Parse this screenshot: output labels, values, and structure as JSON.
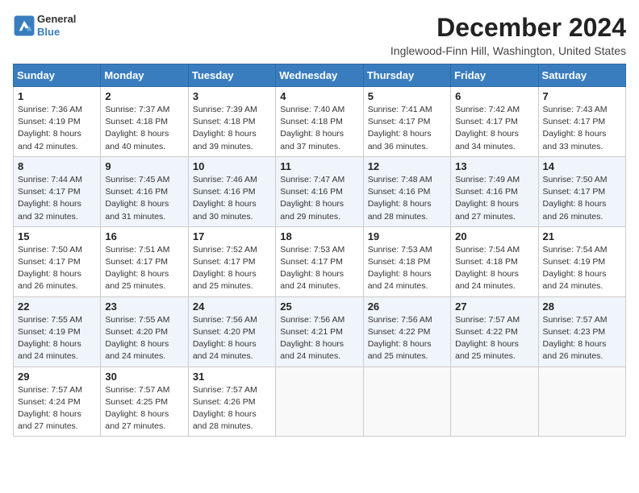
{
  "logo": {
    "general": "General",
    "blue": "Blue"
  },
  "title": "December 2024",
  "location": "Inglewood-Finn Hill, Washington, United States",
  "headers": [
    "Sunday",
    "Monday",
    "Tuesday",
    "Wednesday",
    "Thursday",
    "Friday",
    "Saturday"
  ],
  "weeks": [
    [
      {
        "day": "1",
        "sunrise": "Sunrise: 7:36 AM",
        "sunset": "Sunset: 4:19 PM",
        "daylight": "Daylight: 8 hours and 42 minutes."
      },
      {
        "day": "2",
        "sunrise": "Sunrise: 7:37 AM",
        "sunset": "Sunset: 4:18 PM",
        "daylight": "Daylight: 8 hours and 40 minutes."
      },
      {
        "day": "3",
        "sunrise": "Sunrise: 7:39 AM",
        "sunset": "Sunset: 4:18 PM",
        "daylight": "Daylight: 8 hours and 39 minutes."
      },
      {
        "day": "4",
        "sunrise": "Sunrise: 7:40 AM",
        "sunset": "Sunset: 4:18 PM",
        "daylight": "Daylight: 8 hours and 37 minutes."
      },
      {
        "day": "5",
        "sunrise": "Sunrise: 7:41 AM",
        "sunset": "Sunset: 4:17 PM",
        "daylight": "Daylight: 8 hours and 36 minutes."
      },
      {
        "day": "6",
        "sunrise": "Sunrise: 7:42 AM",
        "sunset": "Sunset: 4:17 PM",
        "daylight": "Daylight: 8 hours and 34 minutes."
      },
      {
        "day": "7",
        "sunrise": "Sunrise: 7:43 AM",
        "sunset": "Sunset: 4:17 PM",
        "daylight": "Daylight: 8 hours and 33 minutes."
      }
    ],
    [
      {
        "day": "8",
        "sunrise": "Sunrise: 7:44 AM",
        "sunset": "Sunset: 4:17 PM",
        "daylight": "Daylight: 8 hours and 32 minutes."
      },
      {
        "day": "9",
        "sunrise": "Sunrise: 7:45 AM",
        "sunset": "Sunset: 4:16 PM",
        "daylight": "Daylight: 8 hours and 31 minutes."
      },
      {
        "day": "10",
        "sunrise": "Sunrise: 7:46 AM",
        "sunset": "Sunset: 4:16 PM",
        "daylight": "Daylight: 8 hours and 30 minutes."
      },
      {
        "day": "11",
        "sunrise": "Sunrise: 7:47 AM",
        "sunset": "Sunset: 4:16 PM",
        "daylight": "Daylight: 8 hours and 29 minutes."
      },
      {
        "day": "12",
        "sunrise": "Sunrise: 7:48 AM",
        "sunset": "Sunset: 4:16 PM",
        "daylight": "Daylight: 8 hours and 28 minutes."
      },
      {
        "day": "13",
        "sunrise": "Sunrise: 7:49 AM",
        "sunset": "Sunset: 4:16 PM",
        "daylight": "Daylight: 8 hours and 27 minutes."
      },
      {
        "day": "14",
        "sunrise": "Sunrise: 7:50 AM",
        "sunset": "Sunset: 4:17 PM",
        "daylight": "Daylight: 8 hours and 26 minutes."
      }
    ],
    [
      {
        "day": "15",
        "sunrise": "Sunrise: 7:50 AM",
        "sunset": "Sunset: 4:17 PM",
        "daylight": "Daylight: 8 hours and 26 minutes."
      },
      {
        "day": "16",
        "sunrise": "Sunrise: 7:51 AM",
        "sunset": "Sunset: 4:17 PM",
        "daylight": "Daylight: 8 hours and 25 minutes."
      },
      {
        "day": "17",
        "sunrise": "Sunrise: 7:52 AM",
        "sunset": "Sunset: 4:17 PM",
        "daylight": "Daylight: 8 hours and 25 minutes."
      },
      {
        "day": "18",
        "sunrise": "Sunrise: 7:53 AM",
        "sunset": "Sunset: 4:17 PM",
        "daylight": "Daylight: 8 hours and 24 minutes."
      },
      {
        "day": "19",
        "sunrise": "Sunrise: 7:53 AM",
        "sunset": "Sunset: 4:18 PM",
        "daylight": "Daylight: 8 hours and 24 minutes."
      },
      {
        "day": "20",
        "sunrise": "Sunrise: 7:54 AM",
        "sunset": "Sunset: 4:18 PM",
        "daylight": "Daylight: 8 hours and 24 minutes."
      },
      {
        "day": "21",
        "sunrise": "Sunrise: 7:54 AM",
        "sunset": "Sunset: 4:19 PM",
        "daylight": "Daylight: 8 hours and 24 minutes."
      }
    ],
    [
      {
        "day": "22",
        "sunrise": "Sunrise: 7:55 AM",
        "sunset": "Sunset: 4:19 PM",
        "daylight": "Daylight: 8 hours and 24 minutes."
      },
      {
        "day": "23",
        "sunrise": "Sunrise: 7:55 AM",
        "sunset": "Sunset: 4:20 PM",
        "daylight": "Daylight: 8 hours and 24 minutes."
      },
      {
        "day": "24",
        "sunrise": "Sunrise: 7:56 AM",
        "sunset": "Sunset: 4:20 PM",
        "daylight": "Daylight: 8 hours and 24 minutes."
      },
      {
        "day": "25",
        "sunrise": "Sunrise: 7:56 AM",
        "sunset": "Sunset: 4:21 PM",
        "daylight": "Daylight: 8 hours and 24 minutes."
      },
      {
        "day": "26",
        "sunrise": "Sunrise: 7:56 AM",
        "sunset": "Sunset: 4:22 PM",
        "daylight": "Daylight: 8 hours and 25 minutes."
      },
      {
        "day": "27",
        "sunrise": "Sunrise: 7:57 AM",
        "sunset": "Sunset: 4:22 PM",
        "daylight": "Daylight: 8 hours and 25 minutes."
      },
      {
        "day": "28",
        "sunrise": "Sunrise: 7:57 AM",
        "sunset": "Sunset: 4:23 PM",
        "daylight": "Daylight: 8 hours and 26 minutes."
      }
    ],
    [
      {
        "day": "29",
        "sunrise": "Sunrise: 7:57 AM",
        "sunset": "Sunset: 4:24 PM",
        "daylight": "Daylight: 8 hours and 27 minutes."
      },
      {
        "day": "30",
        "sunrise": "Sunrise: 7:57 AM",
        "sunset": "Sunset: 4:25 PM",
        "daylight": "Daylight: 8 hours and 27 minutes."
      },
      {
        "day": "31",
        "sunrise": "Sunrise: 7:57 AM",
        "sunset": "Sunset: 4:26 PM",
        "daylight": "Daylight: 8 hours and 28 minutes."
      },
      null,
      null,
      null,
      null
    ]
  ]
}
